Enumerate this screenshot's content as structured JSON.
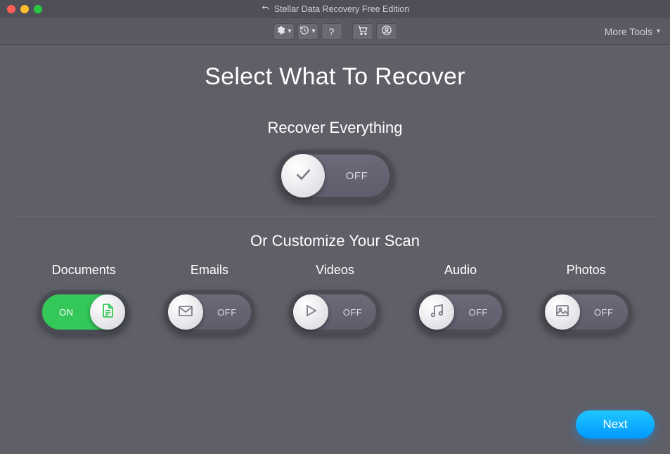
{
  "window": {
    "title": "Stellar Data Recovery Free Edition"
  },
  "toolbar": {
    "more_tools": "More Tools"
  },
  "page": {
    "title": "Select What To Recover",
    "recover_everything_title": "Recover Everything",
    "customize_title": "Or Customize Your Scan"
  },
  "toggles": {
    "everything": {
      "state": "OFF"
    },
    "documents": {
      "label": "Documents",
      "state": "ON"
    },
    "emails": {
      "label": "Emails",
      "state": "OFF"
    },
    "videos": {
      "label": "Videos",
      "state": "OFF"
    },
    "audio": {
      "label": "Audio",
      "state": "OFF"
    },
    "photos": {
      "label": "Photos",
      "state": "OFF"
    }
  },
  "buttons": {
    "next": "Next"
  }
}
